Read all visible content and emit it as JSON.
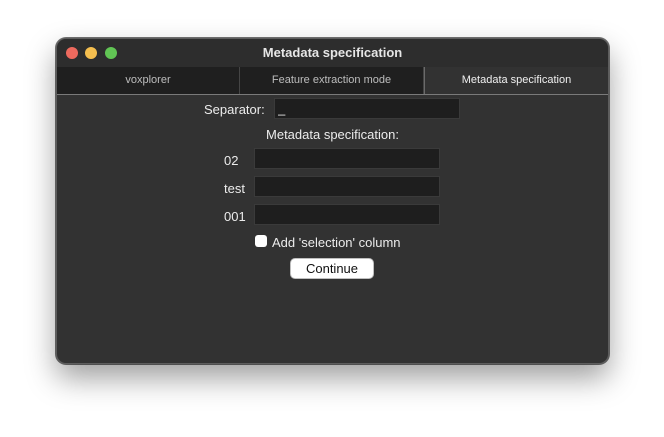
{
  "window": {
    "title": "Metadata specification",
    "traffic_lights": {
      "close": "#ed6a5e",
      "minimize": "#f5bf4f",
      "zoom": "#61c554"
    }
  },
  "tabs": [
    {
      "label": "voxplorer",
      "selected": false
    },
    {
      "label": "Feature extraction mode",
      "selected": false
    },
    {
      "label": "Metadata specification",
      "selected": true
    }
  ],
  "form": {
    "separator_label": "Separator:",
    "separator_value": "_",
    "metadata_heading": "Metadata specification:",
    "fields": [
      {
        "label": "02",
        "value": ""
      },
      {
        "label": "test",
        "value": ""
      },
      {
        "label": "001",
        "value": ""
      }
    ],
    "selection_checkbox_label": "Add 'selection' column",
    "selection_checked": false,
    "continue_label": "Continue"
  }
}
